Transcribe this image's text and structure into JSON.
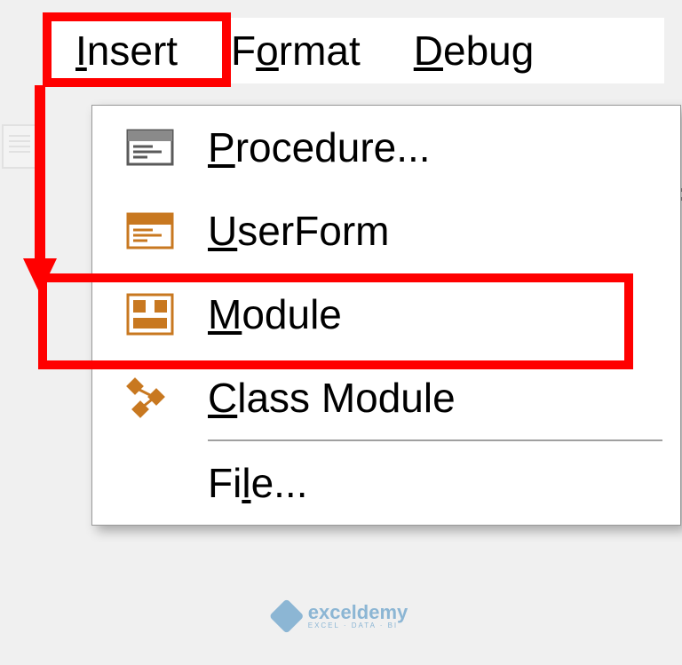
{
  "menubar": {
    "insert": "Insert",
    "format": "Format",
    "debug": "Debug"
  },
  "dropdown": {
    "procedure": "Procedure...",
    "userform": "UserForm",
    "module": "Module",
    "class_module": "Class Module",
    "file": "File..."
  },
  "watermark": {
    "main": "exceldemy",
    "sub": "EXCEL · DATA · BI"
  }
}
